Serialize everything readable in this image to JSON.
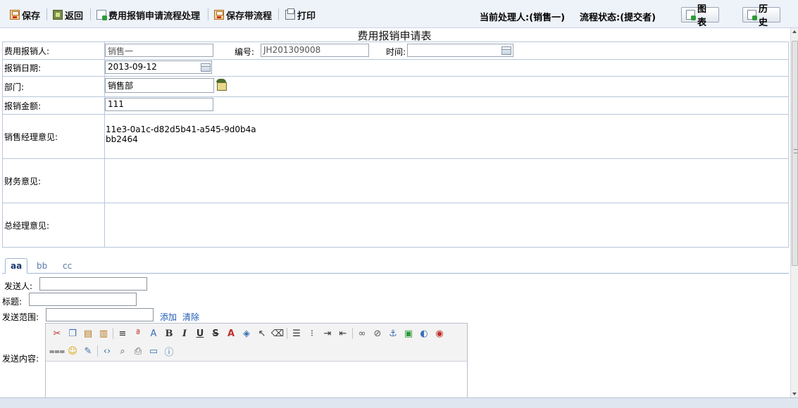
{
  "toolbar": {
    "save": "保存",
    "back": "返回",
    "process": "费用报销申请流程处理",
    "save_flow": "保存带流程",
    "print": "打印",
    "current_handler": "当前处理人:(销售一)",
    "flow_status": "流程状态:(提交者)",
    "chart": "图表",
    "history": "历史"
  },
  "form": {
    "title": "费用报销申请表",
    "applicant_label": "费用报销人:",
    "applicant_value": "销售一",
    "number_label": "编号:",
    "number_value": "JH201309008",
    "time_label": "时间:",
    "time_value": "",
    "date_label": "报销日期:",
    "date_value": "2013-09-12",
    "dept_label": "部门:",
    "dept_value": "销售部",
    "amount_label": "报销金额:",
    "amount_value": "111",
    "sales_opinion_label": "销售经理意见:",
    "sales_opinion_line1": "11e3-0a1c-d82d5b41-a545-9d0b4a",
    "sales_opinion_line2": "bb2464",
    "finance_opinion_label": "财务意见:",
    "gm_opinion_label": "总经理意见:"
  },
  "tabs": [
    "aa",
    "bb",
    "cc"
  ],
  "send": {
    "sender_label": "发送人:",
    "subject_label": "标题:",
    "scope_label": "发送范围:",
    "add": "添加",
    "clear": "清除",
    "content_label": "发送内容:"
  }
}
